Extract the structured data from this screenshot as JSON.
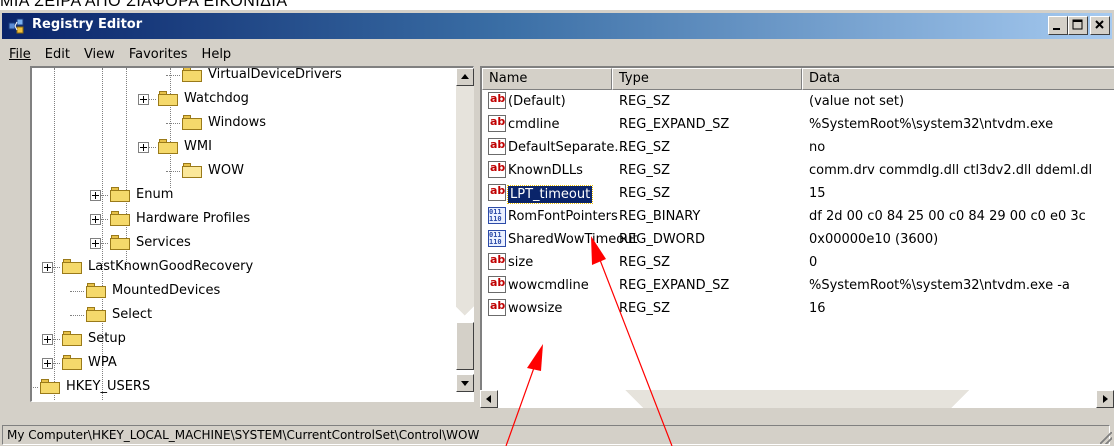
{
  "caption": "ΜΙΑ ΣΕΙΡΑ ΑΠΟ ΣΙΑΦΟΡΑ ΕΙΚΟΝΙΔΙΑ",
  "window": {
    "title": "Registry Editor"
  },
  "menu": [
    {
      "label": "File"
    },
    {
      "label": "Edit"
    },
    {
      "label": "View"
    },
    {
      "label": "Favorites"
    },
    {
      "label": "Help"
    }
  ],
  "tree": {
    "items": [
      {
        "label": "VirtualDeviceDrivers",
        "expandable": false
      },
      {
        "label": "Watchdog",
        "expandable": true
      },
      {
        "label": "Windows",
        "expandable": false
      },
      {
        "label": "WMI",
        "expandable": true
      },
      {
        "label": "WOW",
        "expandable": false,
        "open": true
      },
      {
        "label": "Enum",
        "expandable": true
      },
      {
        "label": "Hardware Profiles",
        "expandable": true
      },
      {
        "label": "Services",
        "expandable": true
      },
      {
        "label": "LastKnownGoodRecovery",
        "expandable": true
      },
      {
        "label": "MountedDevices",
        "expandable": false
      },
      {
        "label": "Select",
        "expandable": false
      },
      {
        "label": "Setup",
        "expandable": true
      },
      {
        "label": "WPA",
        "expandable": true
      },
      {
        "label": "HKEY_USERS",
        "expandable": true
      }
    ]
  },
  "list": {
    "columns": [
      "Name",
      "Type",
      "Data"
    ],
    "rows": [
      {
        "name": "(Default)",
        "type": "REG_SZ",
        "data": "(value not set)",
        "icon": "string-value-icon"
      },
      {
        "name": "cmdline",
        "type": "REG_EXPAND_SZ",
        "data": "%SystemRoot%\\system32\\ntvdm.exe",
        "icon": "string-value-icon"
      },
      {
        "name": "DefaultSeparate...",
        "type": "REG_SZ",
        "data": "no",
        "icon": "string-value-icon"
      },
      {
        "name": "KnownDLLs",
        "type": "REG_SZ",
        "data": "comm.drv commdlg.dll ctl3dv2.dll ddeml.dl",
        "icon": "string-value-icon"
      },
      {
        "name": "LPT_timeout",
        "type": "REG_SZ",
        "data": "15",
        "icon": "string-value-icon",
        "selected": true
      },
      {
        "name": "RomFontPointers",
        "type": "REG_BINARY",
        "data": "df 2d 00 c0 84 25 00 c0 84 29 00 c0 e0 3c",
        "icon": "binary-value-icon"
      },
      {
        "name": "SharedWowTimeout",
        "type": "REG_DWORD",
        "data": "0x00000e10 (3600)",
        "icon": "binary-value-icon"
      },
      {
        "name": "size",
        "type": "REG_SZ",
        "data": "0",
        "icon": "string-value-icon"
      },
      {
        "name": "wowcmdline",
        "type": "REG_EXPAND_SZ",
        "data": "%SystemRoot%\\system32\\ntvdm.exe -a",
        "icon": "string-value-icon"
      },
      {
        "name": "wowsize",
        "type": "REG_SZ",
        "data": "16",
        "icon": "string-value-icon"
      }
    ]
  },
  "status": {
    "path": "My Computer\\HKEY_LOCAL_MACHINE\\SYSTEM\\CurrentControlSet\\Control\\WOW"
  },
  "colors": {
    "annotation_arrow": "#ff0000",
    "title_gradient_start": "#0a246a",
    "selection": "#0a246a"
  }
}
